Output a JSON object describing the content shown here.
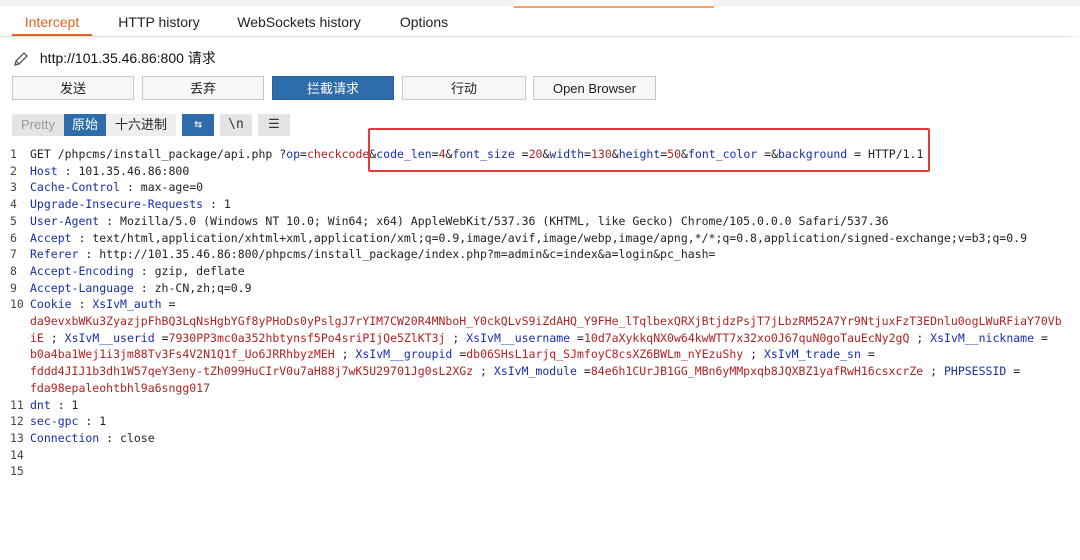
{
  "tabs": {
    "intercept": "Intercept",
    "http_history": "HTTP history",
    "websockets_history": "WebSockets history",
    "options": "Options"
  },
  "request_target": "http://101.35.46.86:800 请求",
  "actions": {
    "forward": "发送",
    "drop": "丢弃",
    "intercept_on": "拦截请求",
    "action": "行动",
    "open_browser": "Open Browser"
  },
  "view_modes": {
    "pretty": "Pretty",
    "raw": "原始",
    "hex": "十六进制",
    "wrap_icon": "⇆",
    "newline_icon": "\\n",
    "menu_icon": "☰"
  },
  "colors": {
    "accent_orange": "#e8631c",
    "primary_blue": "#2e6cab",
    "highlight_red": "#e53935"
  },
  "request": {
    "line_numbers": [
      "1",
      "2",
      "3",
      "4",
      "5",
      "6",
      "7",
      "8",
      "9",
      "10",
      "",
      "",
      "",
      "",
      "11",
      "12",
      "13",
      "14",
      "15"
    ],
    "lines": [
      [
        {
          "c": "p",
          "t": "GET /phpcms/install_package/api.php  ?"
        },
        {
          "c": "k",
          "t": "op"
        },
        {
          "c": "p",
          "t": "="
        },
        {
          "c": "v",
          "t": "checkcode"
        },
        {
          "c": "p",
          "t": "&"
        },
        {
          "c": "k",
          "t": "code_len"
        },
        {
          "c": "p",
          "t": "="
        },
        {
          "c": "v",
          "t": "4"
        },
        {
          "c": "p",
          "t": "&"
        },
        {
          "c": "k",
          "t": "font_size"
        },
        {
          "c": "p",
          "t": " ="
        },
        {
          "c": "v",
          "t": "20"
        },
        {
          "c": "p",
          "t": "&"
        },
        {
          "c": "k",
          "t": "width"
        },
        {
          "c": "p",
          "t": "="
        },
        {
          "c": "v",
          "t": "130"
        },
        {
          "c": "p",
          "t": "&"
        },
        {
          "c": "k",
          "t": "height"
        },
        {
          "c": "p",
          "t": "="
        },
        {
          "c": "v",
          "t": "50"
        },
        {
          "c": "p",
          "t": "&"
        },
        {
          "c": "k",
          "t": "font_color"
        },
        {
          "c": "p",
          "t": " =&"
        },
        {
          "c": "k",
          "t": "background"
        },
        {
          "c": "p",
          "t": " = HTTP/1.1"
        }
      ],
      [
        {
          "c": "k",
          "t": "Host"
        },
        {
          "c": "p",
          "t": " : 101.35.46.86:800"
        }
      ],
      [
        {
          "c": "k",
          "t": "Cache-Control"
        },
        {
          "c": "p",
          "t": " : max-age=0"
        }
      ],
      [
        {
          "c": "k",
          "t": "Upgrade-Insecure-Requests"
        },
        {
          "c": "p",
          "t": "  : 1"
        }
      ],
      [
        {
          "c": "k",
          "t": "User-Agent"
        },
        {
          "c": "p",
          "t": " : Mozilla/5.0  (Windows  NT 10.0; Win64; x64) AppleWebKit/537.36  (KHTML,  like Gecko)  Chrome/105.0.0.0  Safari/537.36"
        }
      ],
      [
        {
          "c": "k",
          "t": "Accept"
        },
        {
          "c": "p",
          "t": " : text/html,application/xhtml+xml,application/xml;q=0.9,image/avif,image/webp,image/apng,*/*;q=0.8,application/signed-exchange;v=b3;q=0.9"
        }
      ],
      [
        {
          "c": "k",
          "t": "Referer"
        },
        {
          "c": "p",
          "t": " : http://101.35.46.86:800/phpcms/install_package/index.php?m=admin&c=index&a=login&pc_hash="
        }
      ],
      [
        {
          "c": "k",
          "t": "Accept-Encoding"
        },
        {
          "c": "p",
          "t": " : gzip,  deflate"
        }
      ],
      [
        {
          "c": "k",
          "t": "Accept-Language"
        },
        {
          "c": "p",
          "t": " : zh-CN,zh;q=0.9"
        }
      ],
      [
        {
          "c": "k",
          "t": "Cookie"
        },
        {
          "c": "p",
          "t": " : "
        },
        {
          "c": "k",
          "t": "XsIvM_auth"
        },
        {
          "c": "p",
          "t": " ="
        }
      ],
      [
        {
          "c": "v",
          "t": "da9evxbWKu3ZyazjpFhBQ3LqNsHgbYGf8yPHoDs0yPslgJ7rYIM7CW20R4MNboH_Y0ckQLvS9iZdAHQ_Y9FHe_lTqlbexQRXjBtjdzPsjT7jLbzRM52A7Yr9NtjuxFzT3EDnlu0ogLWuRFiaY70Vb"
        }
      ],
      [
        {
          "c": "v",
          "t": "iE"
        },
        {
          "c": "p",
          "t": " ; "
        },
        {
          "c": "k",
          "t": "XsIvM__userid"
        },
        {
          "c": "p",
          "t": " ="
        },
        {
          "c": "v",
          "t": "7930PP3mc0a352hbtynsf5Po4sriPIjQe5ZlKT3j"
        },
        {
          "c": "p",
          "t": "   ; "
        },
        {
          "c": "k",
          "t": "XsIvM__username"
        },
        {
          "c": "p",
          "t": " ="
        },
        {
          "c": "v",
          "t": "10d7aXykkqNX0w64kwWTT7x32xo0J67quN0goTauEcNy2gQ"
        },
        {
          "c": "p",
          "t": "    ; "
        },
        {
          "c": "k",
          "t": "XsIvM__nickname"
        },
        {
          "c": "p",
          "t": " ="
        }
      ],
      [
        {
          "c": "v",
          "t": "b0a4ba1Wej1i3jm88Tv3Fs4V2N1Q1f_Uo6JRRhbyzMEH"
        },
        {
          "c": "p",
          "t": "    ; "
        },
        {
          "c": "k",
          "t": "XsIvM__groupid"
        },
        {
          "c": "p",
          "t": " ="
        },
        {
          "c": "v",
          "t": "db06SHsL1arjq_SJmfoyC8csXZ6BWLm_nYEzuShy"
        },
        {
          "c": "p",
          "t": "    ; "
        },
        {
          "c": "k",
          "t": "XsIvM_trade_sn"
        },
        {
          "c": "p",
          "t": " ="
        }
      ],
      [
        {
          "c": "v",
          "t": "fddd4JIJ1b3dh1W57qeY3eny-tZh099HuCIrV0u7aH88j7wK5U29701Jg0sL2XGz"
        },
        {
          "c": "p",
          "t": "     ; "
        },
        {
          "c": "k",
          "t": "XsIvM_module"
        },
        {
          "c": "p",
          "t": " ="
        },
        {
          "c": "v",
          "t": "84e6h1CUrJB1GG_MBn6yMMpxqb8JQXBZ1yafRwH16csxcrZe"
        },
        {
          "c": "p",
          "t": "     ; "
        },
        {
          "c": "k",
          "t": "PHPSESSID"
        },
        {
          "c": "p",
          "t": " ="
        }
      ],
      [
        {
          "c": "v",
          "t": "fda98epaleohtbhl9a6sngg017"
        }
      ],
      [
        {
          "c": "k",
          "t": "dnt"
        },
        {
          "c": "p",
          "t": " : 1"
        }
      ],
      [
        {
          "c": "k",
          "t": "sec-gpc"
        },
        {
          "c": "p",
          "t": " : 1"
        }
      ],
      [
        {
          "c": "k",
          "t": "Connection"
        },
        {
          "c": "p",
          "t": " : close"
        }
      ],
      [],
      []
    ],
    "numbered_lines": [
      "1",
      "2",
      "3",
      "4",
      "5",
      "6",
      "7",
      "8",
      "9",
      "10",
      null,
      null,
      null,
      null,
      null,
      "11",
      "12",
      "13",
      "14",
      "15"
    ]
  }
}
